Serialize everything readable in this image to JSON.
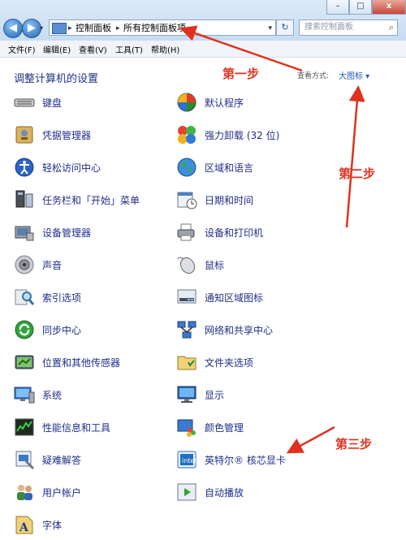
{
  "window": {
    "minimize": "–",
    "maximize": "□",
    "close": "x"
  },
  "address": {
    "crumb1": "控制面板",
    "crumb2": "所有控制面板项",
    "separator": "▸"
  },
  "search": {
    "placeholder": "搜索控制面板"
  },
  "menu": [
    "文件(F)",
    "编辑(E)",
    "查看(V)",
    "工具(T)",
    "帮助(H)"
  ],
  "header": {
    "title": "调整计算机的设置",
    "view_label": "查看方式:",
    "view_value": "大图标 ▾"
  },
  "left_items": [
    {
      "label": "键盘",
      "icon": "keyboard-icon"
    },
    {
      "label": "凭据管理器",
      "icon": "credential-icon"
    },
    {
      "label": "轻松访问中心",
      "icon": "ease-of-access-icon"
    },
    {
      "label": "任务栏和「开始」菜单",
      "icon": "taskbar-icon"
    },
    {
      "label": "设备管理器",
      "icon": "device-manager-icon"
    },
    {
      "label": "声音",
      "icon": "speaker-icon"
    },
    {
      "label": "索引选项",
      "icon": "index-icon"
    },
    {
      "label": "同步中心",
      "icon": "sync-icon"
    },
    {
      "label": "位置和其他传感器",
      "icon": "sensor-icon"
    },
    {
      "label": "系统",
      "icon": "system-icon"
    },
    {
      "label": "性能信息和工具",
      "icon": "performance-icon"
    },
    {
      "label": "疑难解答",
      "icon": "troubleshoot-icon"
    },
    {
      "label": "用户帐户",
      "icon": "users-icon"
    },
    {
      "label": "字体",
      "icon": "font-icon"
    }
  ],
  "right_items": [
    {
      "label": "默认程序",
      "icon": "default-programs-icon"
    },
    {
      "label": "强力卸载 (32 位)",
      "icon": "uninstall-icon"
    },
    {
      "label": "区域和语言",
      "icon": "globe-icon"
    },
    {
      "label": "日期和时间",
      "icon": "calendar-icon"
    },
    {
      "label": "设备和打印机",
      "icon": "printer-icon"
    },
    {
      "label": "鼠标",
      "icon": "mouse-icon"
    },
    {
      "label": "通知区域图标",
      "icon": "notification-icon"
    },
    {
      "label": "网络和共享中心",
      "icon": "network-icon"
    },
    {
      "label": "文件夹选项",
      "icon": "folder-icon"
    },
    {
      "label": "显示",
      "icon": "display-icon"
    },
    {
      "label": "颜色管理",
      "icon": "color-icon"
    },
    {
      "label": "英特尔® 核芯显卡",
      "icon": "intel-graphics-icon"
    },
    {
      "label": "自动播放",
      "icon": "autoplay-icon"
    }
  ],
  "annotations": {
    "step1": "第一步",
    "step2": "第二步",
    "step3": "第三步"
  },
  "colors": {
    "link": "#1e2e8a",
    "annotation": "#e0311e",
    "header": "#1e3287"
  }
}
